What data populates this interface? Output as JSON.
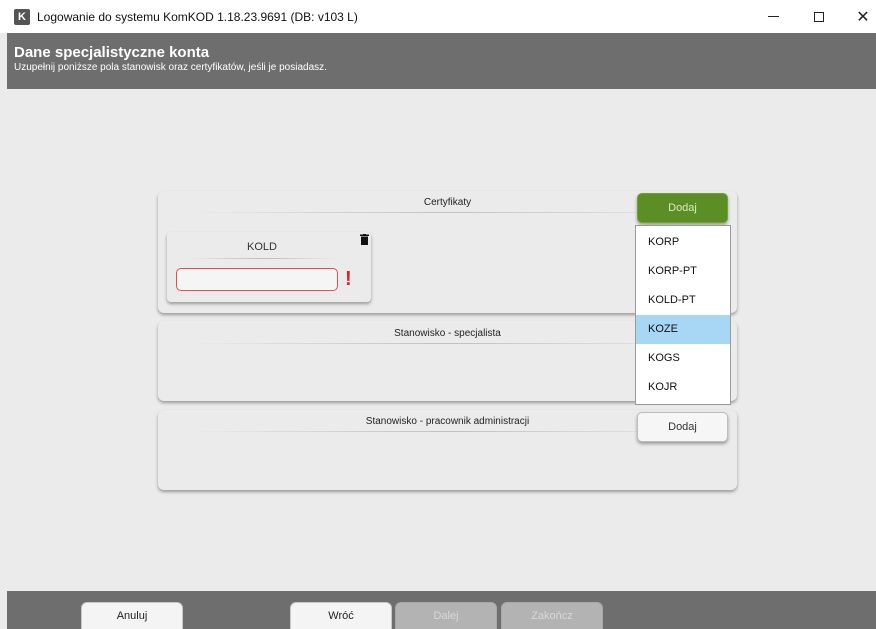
{
  "window": {
    "logo_letter": "K",
    "title": "Logowanie do systemu KomKOD 1.18.23.9691 (DB: v103 L)",
    "minimize_label": "",
    "close_label": "✕"
  },
  "header": {
    "title": "Dane specjalistyczne konta",
    "subtitle": "Uzupełnij poniższe pola stanowisk oraz certyfikatów, jeśli je posiadasz."
  },
  "certificates": {
    "title": "Certyfikaty",
    "add_label": "Dodaj",
    "items": [
      {
        "name": "KOLD",
        "value": ""
      }
    ],
    "dropdown": {
      "options": [
        "KORP",
        "KORP-PT",
        "KOLD-PT",
        "KOZE",
        "KOGS",
        "KOJR"
      ],
      "highlighted": "KOZE"
    }
  },
  "specialist_position": {
    "title": "Stanowisko - specjalista"
  },
  "admin_position": {
    "title": "Stanowisko - pracownik administracji",
    "add_label": "Dodaj"
  },
  "footer": {
    "cancel_label": "Anuluj",
    "back_label": "Wróć",
    "next_label": "Dalej",
    "finish_label": "Zakończ"
  },
  "colors": {
    "accent_green": "#5b8e24",
    "header_gray": "#6e6e6e",
    "error_red": "#e02020",
    "selection_blue": "#a8d6f5"
  }
}
